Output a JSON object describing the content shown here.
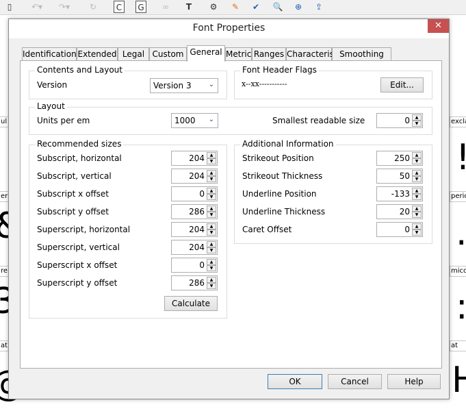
{
  "toolbar": {
    "icons": [
      "page-icon",
      "undo-icon",
      "redo-icon",
      "refresh-icon",
      "c-glyph-icon",
      "g-glyph-icon",
      "link-icon",
      "transform-icon",
      "font-settings-icon",
      "edit-icon",
      "validate-icon",
      "preview-icon",
      "web-icon",
      "upload-icon"
    ],
    "c_label": "C",
    "g_label": "G",
    "t_label": "T"
  },
  "background": {
    "left_labels": [
      "ul",
      "ers",
      "re",
      "at"
    ],
    "left_glyphs": [
      "&",
      "3",
      "@"
    ],
    "right_labels": [
      "excla",
      "perio",
      "mico",
      "at"
    ],
    "right_glyphs": [
      "!",
      ".",
      ":",
      "H"
    ]
  },
  "dialog": {
    "title": "Font Properties",
    "close_label": "✕",
    "tabs": [
      {
        "label": "Identification"
      },
      {
        "label": "Extended"
      },
      {
        "label": "Legal"
      },
      {
        "label": "Custom"
      },
      {
        "label": "General",
        "selected": true
      },
      {
        "label": "Metrics"
      },
      {
        "label": "Ranges"
      },
      {
        "label": "Characteristics"
      },
      {
        "label": "Smoothing"
      }
    ],
    "contents": {
      "title": "Contents and Layout",
      "version_label": "Version",
      "version_value": "Version 3"
    },
    "flags": {
      "title": "Font Header Flags",
      "value": "x--xx-----------",
      "edit_label": "Edit..."
    },
    "layout": {
      "title": "Layout",
      "units_label": "Units per em",
      "units_value": "1000",
      "smallest_label": "Smallest readable size",
      "smallest_value": "0"
    },
    "recommended": {
      "title": "Recommended sizes",
      "rows": [
        {
          "label": "Subscript, horizontal",
          "value": "204"
        },
        {
          "label": "Subscript, vertical",
          "value": "204"
        },
        {
          "label": "Subscript x offset",
          "value": "0"
        },
        {
          "label": "Subscript y offset",
          "value": "286"
        },
        {
          "label": "Superscript, horizontal",
          "value": "204"
        },
        {
          "label": "Superscript, vertical",
          "value": "204"
        },
        {
          "label": "Superscript x offset",
          "value": "0"
        },
        {
          "label": "Superscript y offset",
          "value": "286"
        }
      ],
      "calculate_label": "Calculate"
    },
    "additional": {
      "title": "Additional Information",
      "rows": [
        {
          "label": "Strikeout Position",
          "value": "250"
        },
        {
          "label": "Strikeout Thickness",
          "value": "50"
        },
        {
          "label": "Underline Position",
          "value": "-133"
        },
        {
          "label": "Underline Thickness",
          "value": "20"
        },
        {
          "label": "Caret Offset",
          "value": "0"
        }
      ]
    },
    "buttons": {
      "ok": "OK",
      "cancel": "Cancel",
      "help": "Help"
    }
  }
}
